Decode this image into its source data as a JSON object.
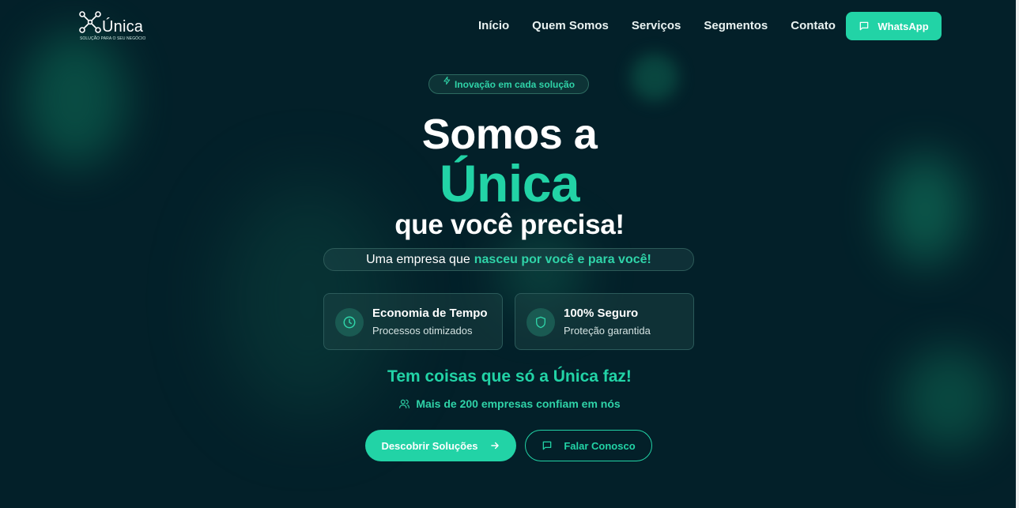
{
  "header": {
    "logo_name": "Única",
    "logo_tagline": "SOLUÇÃO PARA O SEU NEGÓCIO",
    "nav": [
      "Início",
      "Quem Somos",
      "Serviços",
      "Segmentos",
      "Contato"
    ],
    "whatsapp_label": "WhatsApp"
  },
  "hero": {
    "badge": "Inovação em cada solução",
    "title_line1": "Somos a",
    "title_line2": "Única",
    "title_line3": "que você precisa!",
    "subtitle_prefix": "Uma empresa que",
    "subtitle_highlight": "nasceu por você e para você!",
    "features": [
      {
        "icon": "clock-icon",
        "title": "Economia de Tempo",
        "subtitle": "Processos otimizados"
      },
      {
        "icon": "shield-icon",
        "title": "100% Seguro",
        "subtitle": "Proteção garantida"
      }
    ],
    "tagline": "Tem coisas que só a Única faz!",
    "trust": "Mais de 200 empresas confiam em nós",
    "cta_primary": "Descobrir Soluções",
    "cta_secondary": "Falar Conosco"
  },
  "colors": {
    "background": "#032029",
    "accent": "#22d3a6",
    "text": "#ffffff"
  }
}
